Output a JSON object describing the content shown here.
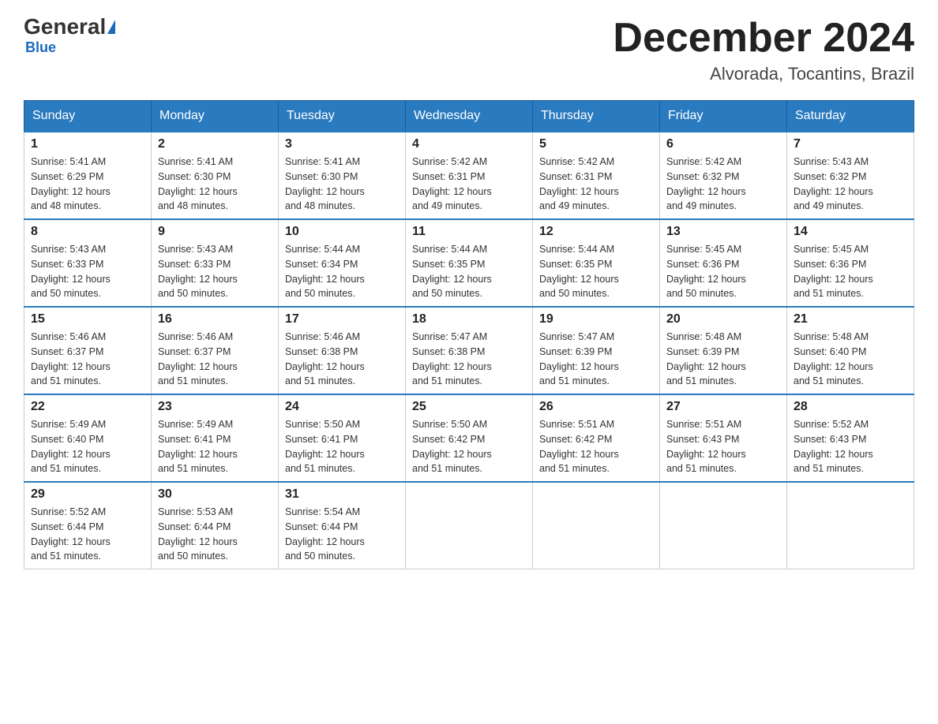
{
  "logo": {
    "general": "General",
    "blue": "Blue",
    "subtitle": "Blue"
  },
  "header": {
    "month": "December 2024",
    "location": "Alvorada, Tocantins, Brazil"
  },
  "weekdays": [
    "Sunday",
    "Monday",
    "Tuesday",
    "Wednesday",
    "Thursday",
    "Friday",
    "Saturday"
  ],
  "weeks": [
    [
      {
        "day": "1",
        "sunrise": "5:41 AM",
        "sunset": "6:29 PM",
        "daylight": "12 hours and 48 minutes."
      },
      {
        "day": "2",
        "sunrise": "5:41 AM",
        "sunset": "6:30 PM",
        "daylight": "12 hours and 48 minutes."
      },
      {
        "day": "3",
        "sunrise": "5:41 AM",
        "sunset": "6:30 PM",
        "daylight": "12 hours and 48 minutes."
      },
      {
        "day": "4",
        "sunrise": "5:42 AM",
        "sunset": "6:31 PM",
        "daylight": "12 hours and 49 minutes."
      },
      {
        "day": "5",
        "sunrise": "5:42 AM",
        "sunset": "6:31 PM",
        "daylight": "12 hours and 49 minutes."
      },
      {
        "day": "6",
        "sunrise": "5:42 AM",
        "sunset": "6:32 PM",
        "daylight": "12 hours and 49 minutes."
      },
      {
        "day": "7",
        "sunrise": "5:43 AM",
        "sunset": "6:32 PM",
        "daylight": "12 hours and 49 minutes."
      }
    ],
    [
      {
        "day": "8",
        "sunrise": "5:43 AM",
        "sunset": "6:33 PM",
        "daylight": "12 hours and 50 minutes."
      },
      {
        "day": "9",
        "sunrise": "5:43 AM",
        "sunset": "6:33 PM",
        "daylight": "12 hours and 50 minutes."
      },
      {
        "day": "10",
        "sunrise": "5:44 AM",
        "sunset": "6:34 PM",
        "daylight": "12 hours and 50 minutes."
      },
      {
        "day": "11",
        "sunrise": "5:44 AM",
        "sunset": "6:35 PM",
        "daylight": "12 hours and 50 minutes."
      },
      {
        "day": "12",
        "sunrise": "5:44 AM",
        "sunset": "6:35 PM",
        "daylight": "12 hours and 50 minutes."
      },
      {
        "day": "13",
        "sunrise": "5:45 AM",
        "sunset": "6:36 PM",
        "daylight": "12 hours and 50 minutes."
      },
      {
        "day": "14",
        "sunrise": "5:45 AM",
        "sunset": "6:36 PM",
        "daylight": "12 hours and 51 minutes."
      }
    ],
    [
      {
        "day": "15",
        "sunrise": "5:46 AM",
        "sunset": "6:37 PM",
        "daylight": "12 hours and 51 minutes."
      },
      {
        "day": "16",
        "sunrise": "5:46 AM",
        "sunset": "6:37 PM",
        "daylight": "12 hours and 51 minutes."
      },
      {
        "day": "17",
        "sunrise": "5:46 AM",
        "sunset": "6:38 PM",
        "daylight": "12 hours and 51 minutes."
      },
      {
        "day": "18",
        "sunrise": "5:47 AM",
        "sunset": "6:38 PM",
        "daylight": "12 hours and 51 minutes."
      },
      {
        "day": "19",
        "sunrise": "5:47 AM",
        "sunset": "6:39 PM",
        "daylight": "12 hours and 51 minutes."
      },
      {
        "day": "20",
        "sunrise": "5:48 AM",
        "sunset": "6:39 PM",
        "daylight": "12 hours and 51 minutes."
      },
      {
        "day": "21",
        "sunrise": "5:48 AM",
        "sunset": "6:40 PM",
        "daylight": "12 hours and 51 minutes."
      }
    ],
    [
      {
        "day": "22",
        "sunrise": "5:49 AM",
        "sunset": "6:40 PM",
        "daylight": "12 hours and 51 minutes."
      },
      {
        "day": "23",
        "sunrise": "5:49 AM",
        "sunset": "6:41 PM",
        "daylight": "12 hours and 51 minutes."
      },
      {
        "day": "24",
        "sunrise": "5:50 AM",
        "sunset": "6:41 PM",
        "daylight": "12 hours and 51 minutes."
      },
      {
        "day": "25",
        "sunrise": "5:50 AM",
        "sunset": "6:42 PM",
        "daylight": "12 hours and 51 minutes."
      },
      {
        "day": "26",
        "sunrise": "5:51 AM",
        "sunset": "6:42 PM",
        "daylight": "12 hours and 51 minutes."
      },
      {
        "day": "27",
        "sunrise": "5:51 AM",
        "sunset": "6:43 PM",
        "daylight": "12 hours and 51 minutes."
      },
      {
        "day": "28",
        "sunrise": "5:52 AM",
        "sunset": "6:43 PM",
        "daylight": "12 hours and 51 minutes."
      }
    ],
    [
      {
        "day": "29",
        "sunrise": "5:52 AM",
        "sunset": "6:44 PM",
        "daylight": "12 hours and 51 minutes."
      },
      {
        "day": "30",
        "sunrise": "5:53 AM",
        "sunset": "6:44 PM",
        "daylight": "12 hours and 50 minutes."
      },
      {
        "day": "31",
        "sunrise": "5:54 AM",
        "sunset": "6:44 PM",
        "daylight": "12 hours and 50 minutes."
      },
      null,
      null,
      null,
      null
    ]
  ],
  "labels": {
    "sunrise_prefix": "Sunrise: ",
    "sunset_prefix": "Sunset: ",
    "daylight_prefix": "Daylight: "
  }
}
